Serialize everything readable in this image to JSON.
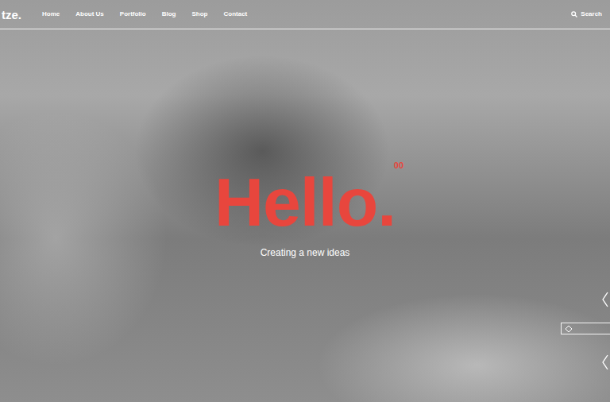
{
  "logo": "tze.",
  "nav": {
    "items": [
      {
        "label": "Home"
      },
      {
        "label": "About Us"
      },
      {
        "label": "Portfolio"
      },
      {
        "label": "Blog"
      },
      {
        "label": "Shop"
      },
      {
        "label": "Contact"
      }
    ]
  },
  "search": {
    "label": "Search"
  },
  "hero": {
    "title": "Hello.",
    "counter": "00",
    "subtitle": "Creating a new ideas"
  }
}
